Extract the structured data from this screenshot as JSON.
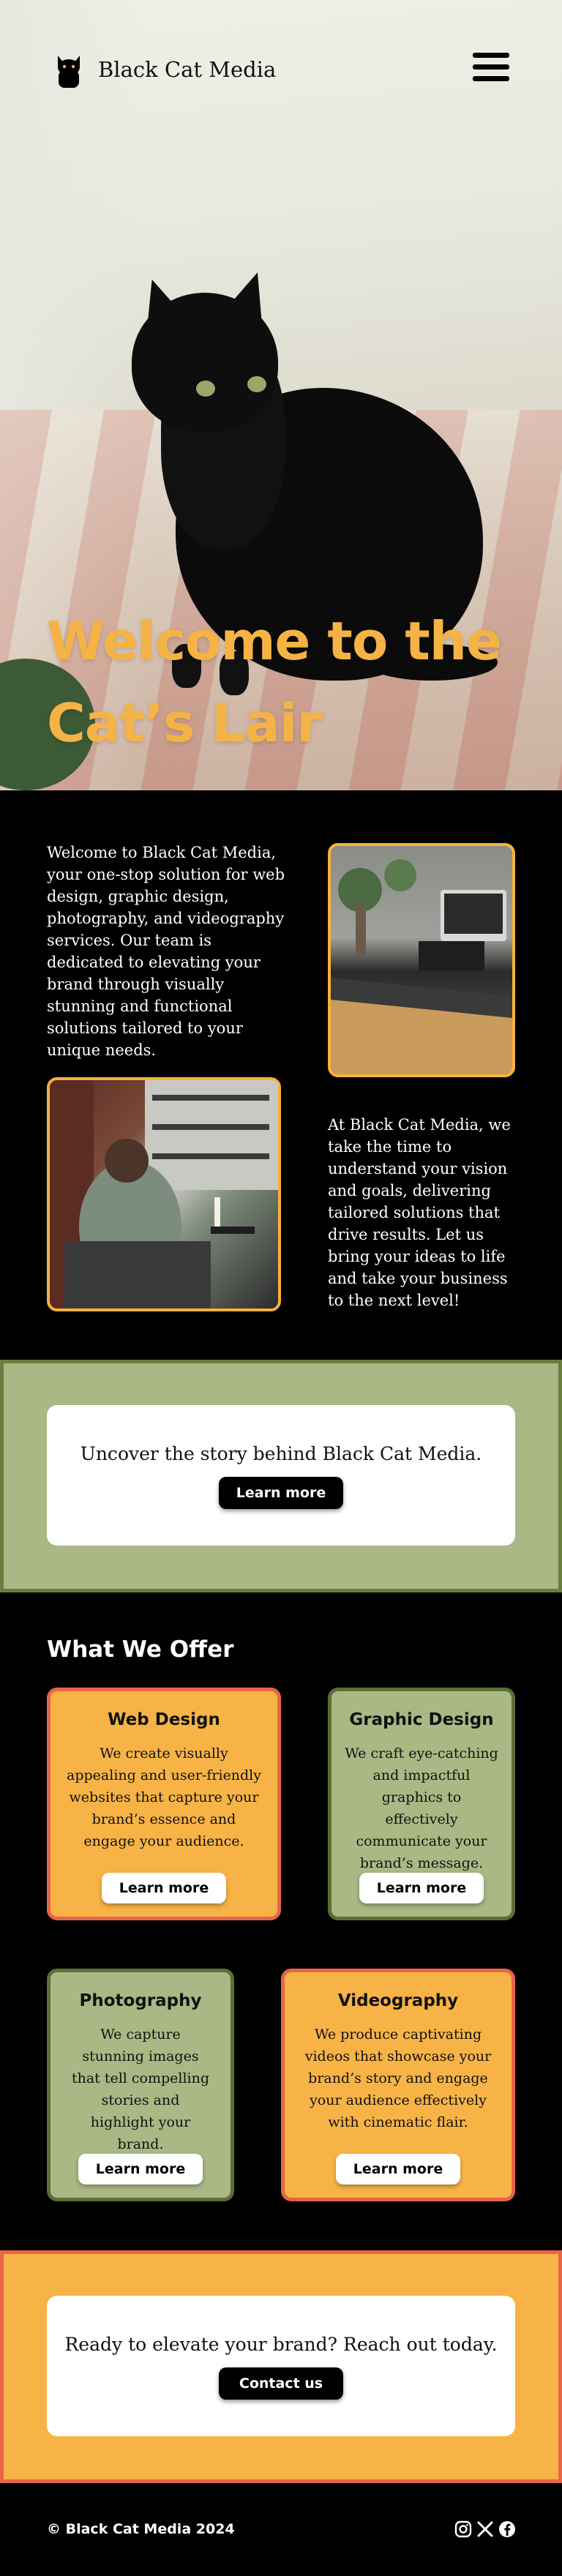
{
  "header": {
    "brand": "Black Cat Media",
    "logo_icon": "black-cat-icon",
    "menu_icon": "hamburger-menu-icon"
  },
  "hero": {
    "title_line1": "Welcome to the",
    "title_line2": "Cat’s Lair"
  },
  "intro": {
    "paragraph1": "Welcome to Black Cat Media, your one-stop solution for web design, graphic design, photography, and videography services. Our team is dedicated to elevating your brand through visually stunning and functional solutions tailored to your unique needs.",
    "paragraph2": "At Black Cat Media, we take the time to understand your vision and goals, delivering tailored solutions that drive results. Let us bring your ideas to life and take your business to the next level!"
  },
  "story": {
    "text": "Uncover the story behind Black Cat Media.",
    "button": "Learn more"
  },
  "offers": {
    "title": "What We Offer",
    "items": [
      {
        "title": "Web Design",
        "text": "We create visually appealing and user-friendly websites that capture your brand’s essence and engage your audience.",
        "button": "Learn more"
      },
      {
        "title": "Graphic Design",
        "text": "We craft eye-catching and impactful graphics to effectively communicate your brand’s message.",
        "button": "Learn more"
      },
      {
        "title": "Photography",
        "text": "We capture stunning images that tell compelling stories and highlight your brand.",
        "button": "Learn more"
      },
      {
        "title": "Videography",
        "text": "We produce captivating videos that showcase your brand’s story and engage your audience effectively with cinematic flair.",
        "button": "Learn more"
      }
    ]
  },
  "contact": {
    "text": "Ready to elevate your brand? Reach out today.",
    "button": "Contact us"
  },
  "footer": {
    "copyright": "© Black Cat Media 2024",
    "social": [
      "instagram-icon",
      "x-icon",
      "facebook-icon"
    ]
  },
  "colors": {
    "accent_orange": "#f7b346",
    "accent_red": "#e8654a",
    "accent_green": "#a9b884",
    "dark_green": "#5e6e36",
    "background": "#000000"
  }
}
